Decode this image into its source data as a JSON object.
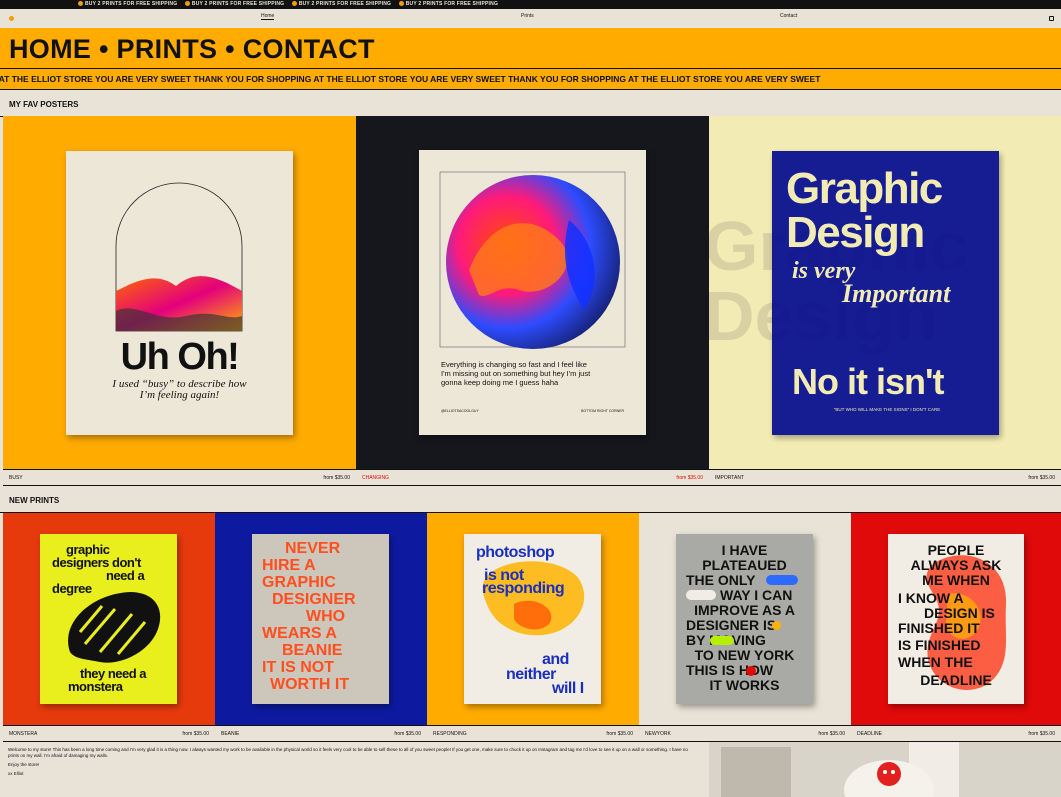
{
  "announcement": {
    "messages": [
      "BUY 2 PRINTS FOR FREE SHIPPING",
      "BUY 2 PRINTS FOR FREE SHIPPING",
      "BUY 2 PRINTS FOR FREE SHIPPING",
      "BUY 2 PRINTS FOR FREE SHIPPING"
    ]
  },
  "nav": {
    "home": "Home",
    "prints": "Prints",
    "contact": "Contact"
  },
  "hero": {
    "title": "HOME • PRINTS • CONTACT"
  },
  "marquee": {
    "text": "G AT THE ELLIOT STORE YOU ARE VERY SWEET THANK YOU FOR SHOPPING AT THE ELLIOT STORE YOU ARE VERY SWEET THANK YOU FOR SHOPPING AT THE ELLIOT STORE YOU ARE VERY SWEET"
  },
  "fav": {
    "title": "MY FAV POSTERS",
    "items": [
      {
        "name": "BUSY",
        "price": "from $35.00",
        "bg": "#ffab00",
        "poster": {
          "headline": "Uh Oh!",
          "sub1": "I used “busy” to describe how",
          "sub2": "I’m feeling again!"
        }
      },
      {
        "name": "CHANGING",
        "price": "from $35.00",
        "bg": "#15171c",
        "poster": {
          "line1": "Everything is changing so fast          and I feel like",
          "line2": "I'm missing out on          something but hey I'm just",
          "line3": "gonna keep doing me I guess haha",
          "left": "@ELLIOTSACOOLGUY",
          "right": "BOTTOM RIGHT CORNER"
        }
      },
      {
        "name": "IMPORTANT",
        "price": "from $35.00",
        "bg": "#f2ecb4",
        "poster": {
          "l1": "Graphic",
          "l2": "Design",
          "l3": "is very",
          "l4": "Important",
          "l5": "No it isn't",
          "foot": "\"BUT WHO WILL MAKE THE SIGNS\" I DON'T CARE"
        }
      }
    ]
  },
  "newprints": {
    "title": "NEW PRINTS",
    "items": [
      {
        "name": "MONSTERA",
        "price": "from $35.00",
        "bg": "#e63a0c",
        "poster": {
          "top1": "graphic",
          "top2": "designers don't",
          "top3": "need a",
          "top4": "degree",
          "bot1": "they need a",
          "bot2": "monstera"
        }
      },
      {
        "name": "BEANIE",
        "price": "from $35.00",
        "bg": "#0d1aa0",
        "poster": {
          "l1": "NEVER",
          "l2": "HIRE          A",
          "l3": "GRAPHIC",
          "l4": "DESIGNER",
          "l5": "WHO",
          "l6": "WEARS      A",
          "l7": "BEANIE",
          "l8": "IT IS      NOT",
          "l9": "WORTH IT"
        }
      },
      {
        "name": "RESPONDING",
        "price": "from $35.00",
        "bg": "#ffab00",
        "poster": {
          "l1": "photoshop",
          "l2": "is not",
          "l3": "responding",
          "l4": "and",
          "l5": "neither",
          "l6": "will I"
        }
      },
      {
        "name": "NEWYORK",
        "price": "from $35.00",
        "bg": "#e8e3d6",
        "poster": {
          "l1": "I HAVE",
          "l2": "PLATEAUED",
          "l3": "THE ONLY",
          "l4": "WAY I CAN",
          "l5": "IMPROVE AS A",
          "l6": "DESIGNER    IS",
          "l7": "BY      MOVING",
          "l8": "TO NEW YORK",
          "l9": "THIS IS    HOW",
          "l10": "IT WORKS"
        }
      },
      {
        "name": "DEADLINE",
        "price": "from $35.00",
        "bg": "#e00a0a",
        "poster": {
          "l1": "PEOPLE",
          "l2": "ALWAYS ASK",
          "l3": "ME WHEN",
          "l4": "I KNOW A",
          "l5": "DESIGN IS",
          "l6": "FINISHED    IT",
          "l7": "IS    FINISHED",
          "l8": "WHEN   THE",
          "l9": "DEADLINE"
        }
      }
    ]
  },
  "about": {
    "p1": "Welcome to my store! This has been a long time coming and I'm very glad it is a thing now. I always wanted my work to be available in the physical world so it feels very cool to be able to sell these to all of you sweet people! If you get one, make sure to chuck it up on Instagram and tag me I'd love to see it up on a wall or something. I have no prints on my wall. I'm afraid of damaging my walls.",
    "p2": "Enjoy the store!",
    "p3": "xx Elliot"
  },
  "colors": {
    "orange": "#ffab00",
    "dark": "#111111",
    "cream": "#e8e3d6",
    "red": "#e00a0a",
    "blue": "#0d1aa0"
  }
}
